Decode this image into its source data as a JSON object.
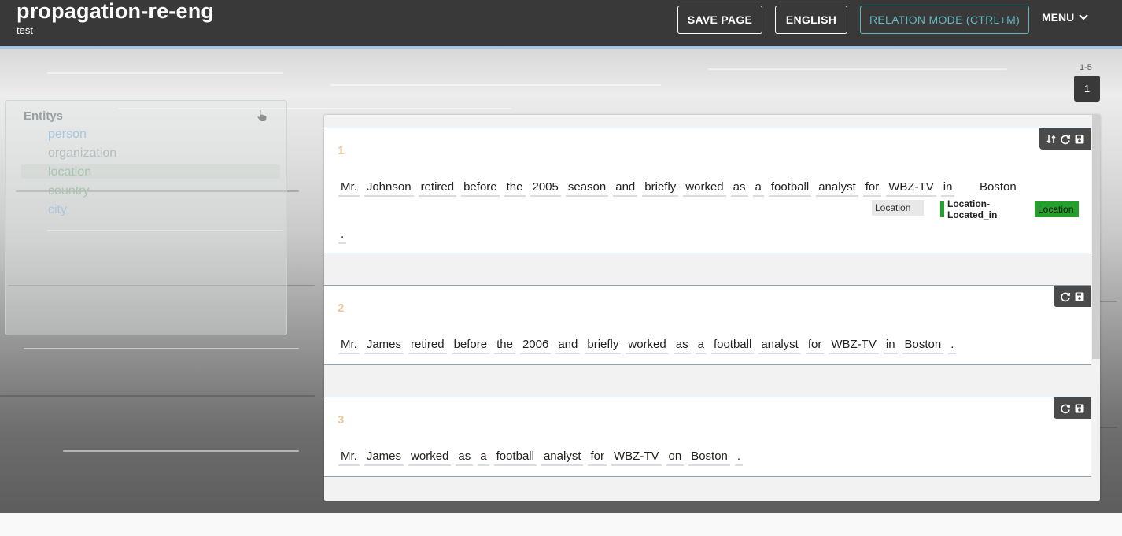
{
  "header": {
    "title": "propagation-re-eng",
    "subtitle": "test",
    "save_label": "SAVE PAGE",
    "lang_label": "ENGLISH",
    "relation_label": "RELATION MODE (CTRL+M)",
    "menu_label": "MENU"
  },
  "pagination": {
    "range": "1-5",
    "current": "1"
  },
  "entity_panel": {
    "title": "Entitys",
    "items": [
      {
        "label": "person",
        "color": "#a9c7dc"
      },
      {
        "label": "organization",
        "color": "#b8bcbc"
      },
      {
        "label": "location",
        "color": "#a9c4b1"
      },
      {
        "label": "country",
        "color": "#a9c4b1"
      },
      {
        "label": "city",
        "color": "#a9c7dc"
      }
    ]
  },
  "sentences": [
    {
      "number": "1",
      "tokens_line1": [
        "Mr.",
        "Johnson",
        "retired",
        "before",
        "the",
        "2005",
        "season",
        "and",
        "briefly",
        "worked",
        "as",
        "a",
        "football",
        "analyst",
        "for",
        "WBZ-TV",
        "in"
      ],
      "boston": "Boston",
      "tokens_line2": [
        "."
      ],
      "tags": {
        "location_gray": "Location",
        "relation": "Location-Located_in",
        "location_green": "Location"
      }
    },
    {
      "number": "2",
      "tokens": [
        "Mr.",
        "James",
        "retired",
        "before",
        "the",
        "2006",
        "and",
        "briefly",
        "worked",
        "as",
        "a",
        "football",
        "analyst",
        "for",
        "WBZ-TV",
        "in",
        "Boston",
        "."
      ]
    },
    {
      "number": "3",
      "tokens": [
        "Mr.",
        "James",
        "worked",
        "as",
        "a",
        "football",
        "analyst",
        "for",
        "WBZ-TV",
        "on",
        "Boston",
        "."
      ]
    }
  ],
  "icons": {
    "menu_chevron": "chevron-down-icon",
    "hand": "hand-pointer-icon",
    "swap": "swap-icon",
    "refresh": "refresh-icon",
    "save": "save-icon"
  }
}
